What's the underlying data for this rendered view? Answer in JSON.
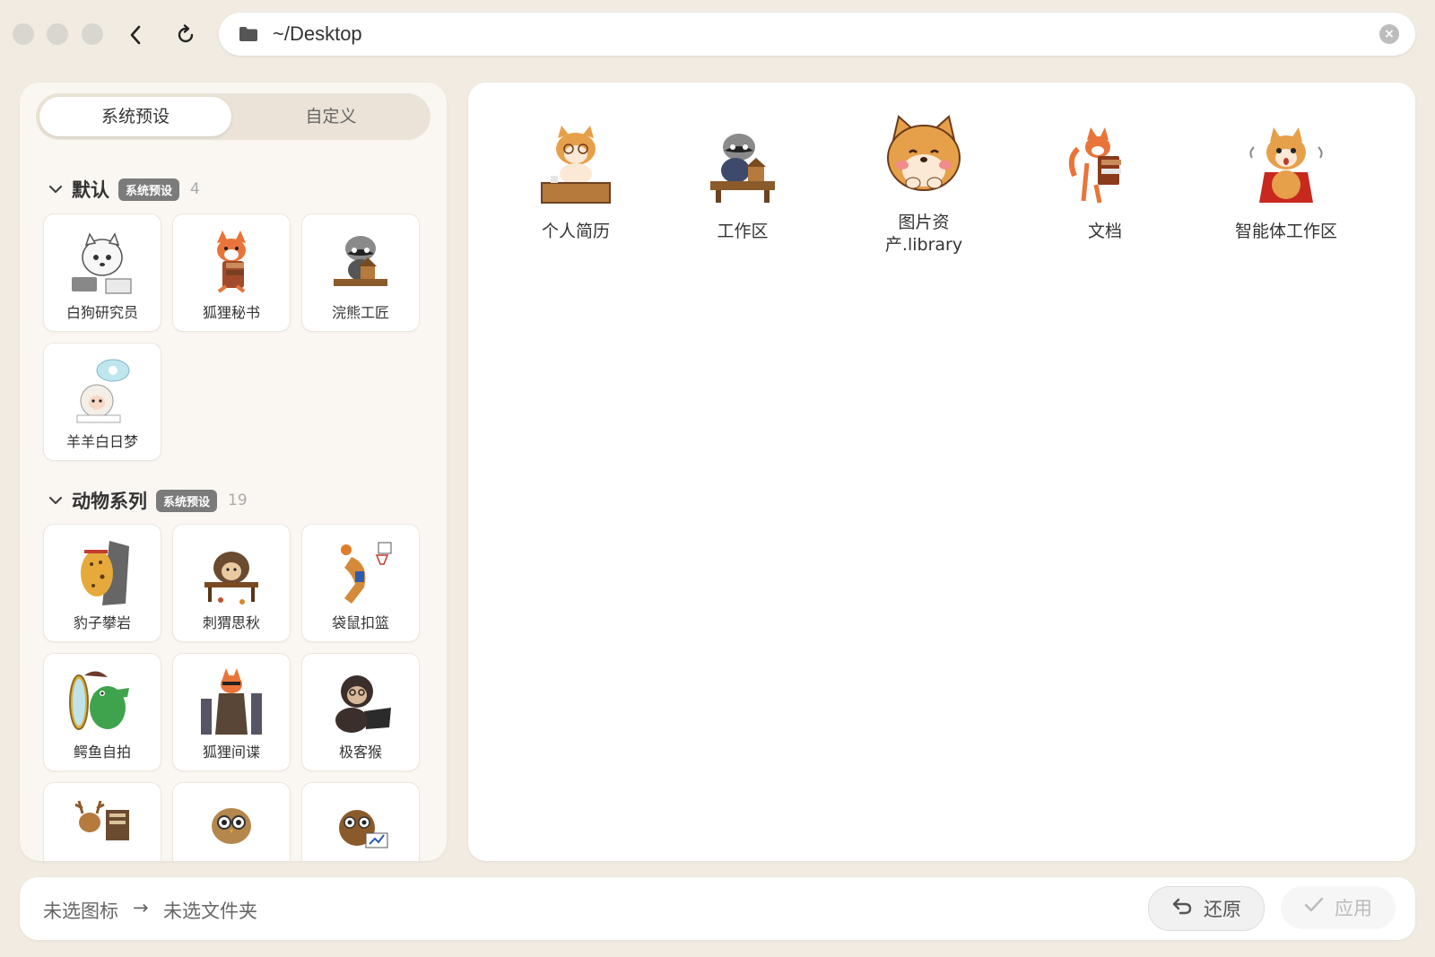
{
  "address_bar": {
    "path": "~/Desktop"
  },
  "tabs": [
    {
      "label": "系统预设"
    },
    {
      "label": "自定义"
    }
  ],
  "groups": [
    {
      "title": "默认",
      "badge": "系统预设",
      "count": "4",
      "items": [
        "白狗研究员",
        "狐狸秘书",
        "浣熊工匠",
        "羊羊白日梦"
      ]
    },
    {
      "title": "动物系列",
      "badge": "系统预设",
      "count": "19",
      "items": [
        "豹子攀岩",
        "刺猬思秋",
        "袋鼠扣篮",
        "鳄鱼自拍",
        "狐狸间谍",
        "极客猴"
      ]
    }
  ],
  "folders": [
    {
      "line1": "个人简历",
      "line2": ""
    },
    {
      "line1": "工作区",
      "line2": ""
    },
    {
      "line1": "图片资",
      "line2": "产.library"
    },
    {
      "line1": "文档",
      "line2": ""
    },
    {
      "line1": "智能体工作区",
      "line2": ""
    }
  ],
  "status": {
    "icon": "未选图标",
    "arrow": "→",
    "folder": "未选文件夹"
  },
  "buttons": {
    "restore": "还原",
    "apply": "应用"
  },
  "colors": {
    "background": "#f1ebe2",
    "panel": "#faf7f2",
    "badge": "#7b7b7b"
  },
  "icons": {
    "back": "chevron-left-icon",
    "reload": "reload-icon",
    "folder": "folder-icon",
    "clear": "clear-icon",
    "collapse": "chevron-down-icon",
    "restore": "undo-icon",
    "apply": "checkmark-icon"
  }
}
